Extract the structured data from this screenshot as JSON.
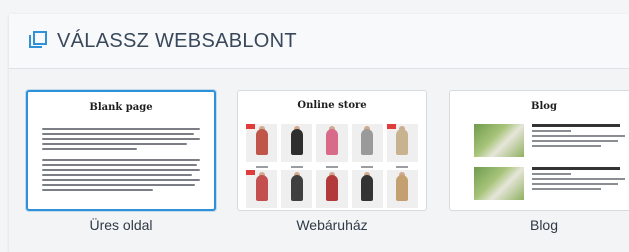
{
  "header": {
    "title": "VÁLASSZ WEBSABLONT",
    "icon": "copy-icon"
  },
  "templates": [
    {
      "thumb_title": "Blank page",
      "caption": "Üres oldal",
      "selected": true
    },
    {
      "thumb_title": "Online store",
      "caption": "Webáruház",
      "selected": false
    },
    {
      "thumb_title": "Blog",
      "caption": "Blog",
      "selected": false
    }
  ],
  "colors": {
    "accent": "#2f92d8",
    "title_text": "#39485a",
    "caption_text": "#2f3a46"
  }
}
